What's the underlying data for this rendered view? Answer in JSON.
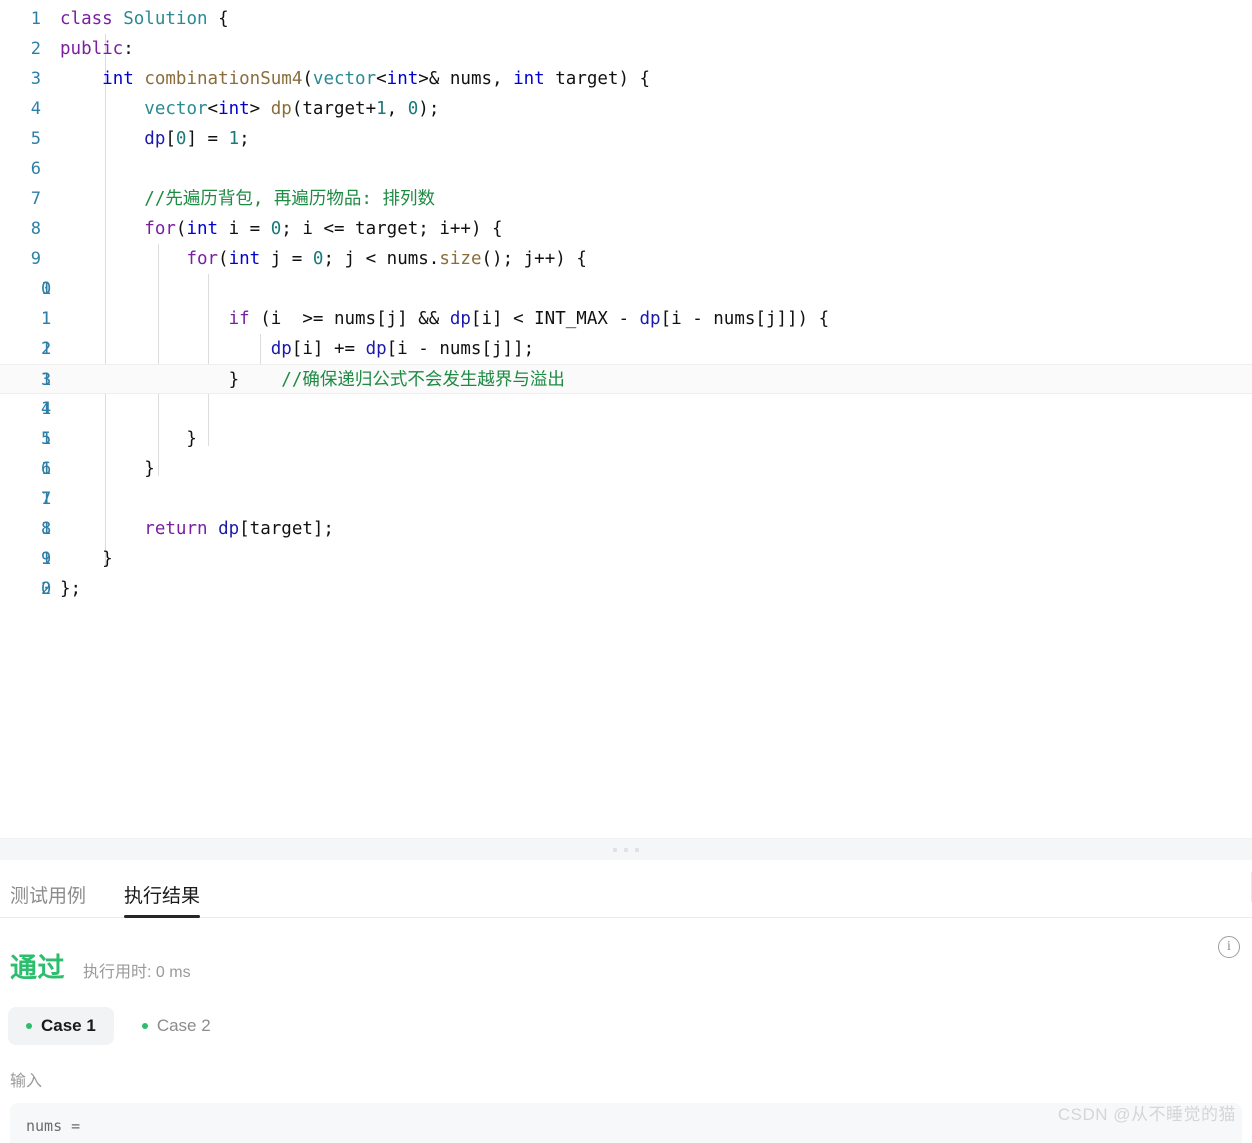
{
  "editor": {
    "language": "cpp",
    "current_line": 12,
    "total_lines": 20,
    "gutter_numbers": [
      "1",
      "2",
      "3",
      "4",
      "5",
      "6",
      "7",
      "8",
      "9",
      "10",
      "11",
      "12",
      "13",
      "14",
      "15",
      "16",
      "17",
      "18",
      "19",
      "20"
    ],
    "lines": [
      {
        "n": "1",
        "text": "class Solution {"
      },
      {
        "n": "2",
        "text": "public:"
      },
      {
        "n": "3",
        "text": "    int combinationSum4(vector<int>& nums, int target) {"
      },
      {
        "n": "4",
        "text": "        vector<int> dp(target+1, 0);"
      },
      {
        "n": "5",
        "text": "        dp[0] = 1;"
      },
      {
        "n": "6",
        "text": ""
      },
      {
        "n": "7",
        "text": "        //先遍历背包, 再遍历物品: 排列数"
      },
      {
        "n": "8",
        "text": "        for(int i = 0; i <= target; i++) {"
      },
      {
        "n": "9",
        "text": "            for(int j = 0; j < nums.size(); j++) {"
      },
      {
        "n": "10",
        "text": ""
      },
      {
        "n": "11",
        "text": "                if (i  >= nums[j] && dp[i] < INT_MAX - dp[i - nums[j]]) {"
      },
      {
        "n": "12",
        "text": "                    dp[i] += dp[i - nums[j]];"
      },
      {
        "n": "13",
        "text": "                }    //确保递归公式不会发生越界与溢出"
      },
      {
        "n": "14",
        "text": ""
      },
      {
        "n": "15",
        "text": "            }"
      },
      {
        "n": "16",
        "text": "        }"
      },
      {
        "n": "17",
        "text": ""
      },
      {
        "n": "18",
        "text": "        return dp[target];"
      },
      {
        "n": "19",
        "text": "    }"
      },
      {
        "n": "20",
        "text": "};"
      }
    ]
  },
  "splitter": {
    "handle": "drag-handle-dots"
  },
  "panel": {
    "tabs": [
      {
        "label": "测试用例",
        "active": false
      },
      {
        "label": "执行结果",
        "active": true
      }
    ],
    "result": {
      "verdict": "通过",
      "verdict_color": "#2dbd6e",
      "runtime_label": "执行用时: 0 ms",
      "info_icon_glyph": "i"
    },
    "cases": [
      {
        "label": "Case 1",
        "active": true,
        "dot_color": "#2dbd6e"
      },
      {
        "label": "Case 2",
        "active": false,
        "dot_color": "#2dbd6e"
      }
    ],
    "input_section": {
      "label": "输入",
      "value": "nums ="
    }
  },
  "watermark": "CSDN @从不睡觉的猫"
}
